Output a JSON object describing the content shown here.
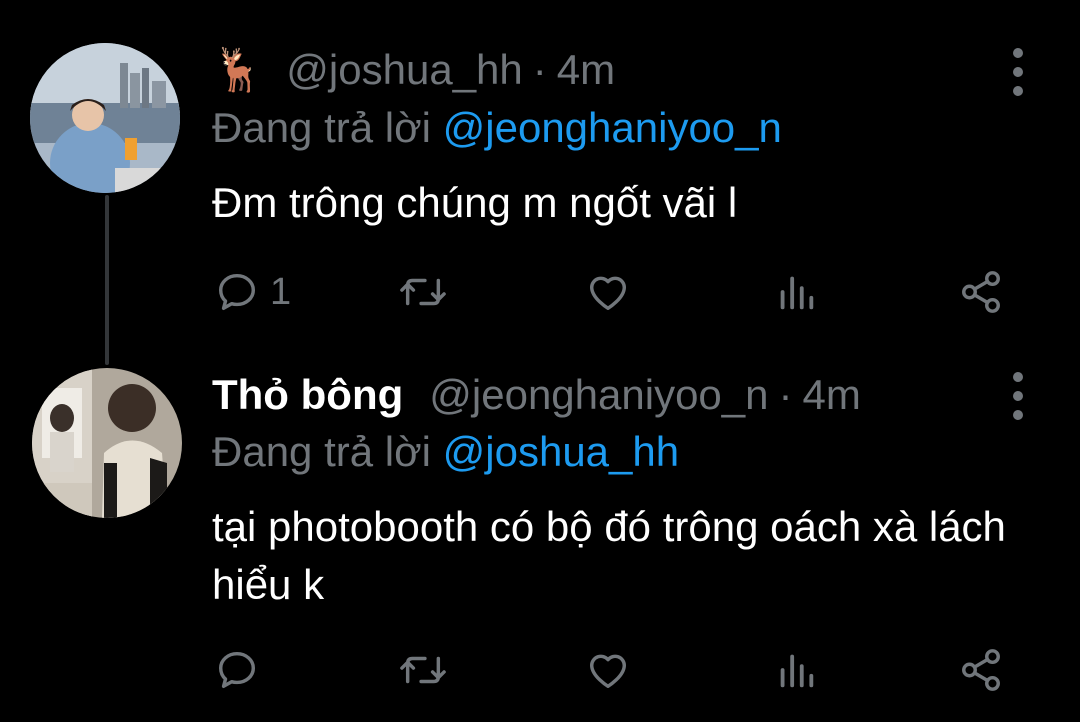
{
  "tweets": [
    {
      "emoji": "🦌",
      "handle": "@joshua_hh",
      "separator": "·",
      "time": "4m",
      "replying_label": "Đang trả lời",
      "replying_to": "@jeonghaniyoo_n",
      "text": "Đm trông chúng m ngốt vãi l",
      "reply_count": "1"
    },
    {
      "display_name": "Thỏ bông",
      "handle": "@jeonghaniyoo_n",
      "separator": "·",
      "time": "4m",
      "replying_label": "Đang trả lời",
      "replying_to": "@joshua_hh",
      "text": "tại photobooth có bộ đó trông oách xà lách hiểu k",
      "reply_count": ""
    }
  ],
  "icons": {
    "reply": "reply-icon",
    "retweet": "retweet-icon",
    "like": "heart-icon",
    "views": "views-icon",
    "share": "share-icon",
    "more": "more-vertical-icon"
  },
  "colors": {
    "background": "#000000",
    "primary_text": "#ffffff",
    "secondary_text": "#71767b",
    "mention": "#1d9bf0",
    "thread_line": "#333639"
  }
}
